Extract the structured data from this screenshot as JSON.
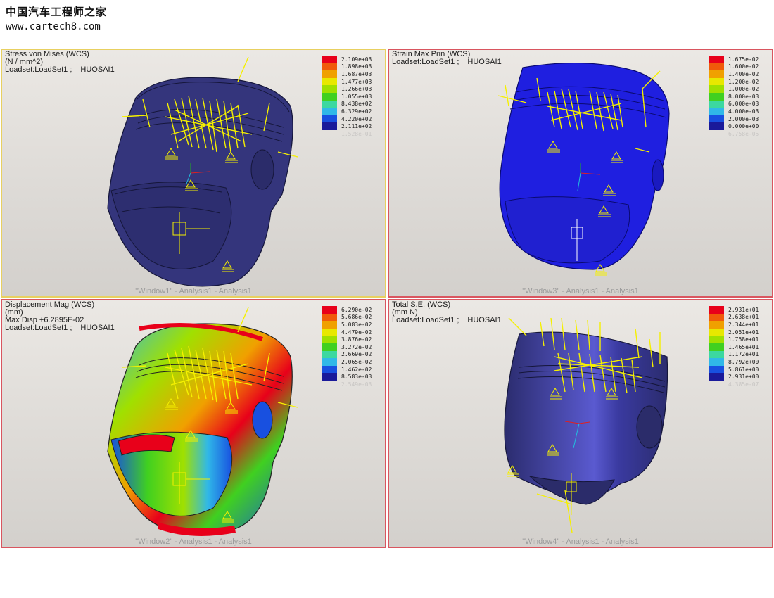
{
  "watermark": {
    "site_name": "中国汽车工程师之家",
    "url": "www.cartech8.com"
  },
  "windows": [
    {
      "id": "window1",
      "lines": [
        "Stress von Mises (WCS)",
        "(N / mm^2)"
      ],
      "loadset": "Loadset:LoadSet1 ;",
      "load_name": "HUOSAI1",
      "legend": [
        "2.109e+03",
        "1.898e+03",
        "1.687e+03",
        "1.477e+03",
        "1.266e+03",
        "1.055e+03",
        "8.438e+02",
        "6.329e+02",
        "4.220e+02",
        "2.111e+02",
        "1.528e-01"
      ],
      "footer": "\"Window1\" - Analysis1 - Analysis1"
    },
    {
      "id": "window3",
      "lines": [
        "Strain Max Prin (WCS)"
      ],
      "loadset": "Loadset:LoadSet1 ;",
      "load_name": "HUOSAI1",
      "legend": [
        "1.675e-02",
        "1.600e-02",
        "1.400e-02",
        "1.200e-02",
        "1.000e-02",
        "8.000e-03",
        "6.000e-03",
        "4.000e-03",
        "2.000e-03",
        "0.000e+00",
        "6.758e-05"
      ],
      "footer": "\"Window3\" - Analysis1 - Analysis1"
    },
    {
      "id": "window2",
      "lines": [
        "Displacement Mag (WCS)",
        "(mm)",
        "Max Disp  +6.2895E-02"
      ],
      "loadset": "Loadset:LoadSet1 ;",
      "load_name": "HUOSAI1",
      "legend": [
        "6.290e-02",
        "5.686e-02",
        "5.083e-02",
        "4.479e-02",
        "3.876e-02",
        "3.272e-02",
        "2.669e-02",
        "2.065e-02",
        "1.462e-02",
        "8.583e-03",
        "2.549e-03"
      ],
      "footer": "\"Window2\" - Analysis1 - Analysis1"
    },
    {
      "id": "window4",
      "lines": [
        "Total S.E.  (WCS)",
        "(mm N)"
      ],
      "loadset": "Loadset:LoadSet1 ;",
      "load_name": "HUOSAI1",
      "legend": [
        "2.931e+01",
        "2.638e+01",
        "2.344e+01",
        "2.051e+01",
        "1.758e+01",
        "1.465e+01",
        "1.172e+01",
        "8.792e+00",
        "5.861e+00",
        "2.931e+00",
        "4.385e-07"
      ],
      "footer": "\"Window4\" - Analysis1 - Analysis1"
    }
  ],
  "colors": {
    "legend_scale": [
      "#e8001a",
      "#f05a0a",
      "#f0a000",
      "#e8e800",
      "#a0e000",
      "#40d020",
      "#3cd8a0",
      "#30b8e8",
      "#1850e0",
      "#1a1a9a",
      "#262868"
    ],
    "active_border": "#e8d060",
    "inactive_border": "#d9555f",
    "piston_dark_blue": "#34357c",
    "piston_bright_blue": "#1f1fe0",
    "load_arrows": "#f5f000"
  }
}
